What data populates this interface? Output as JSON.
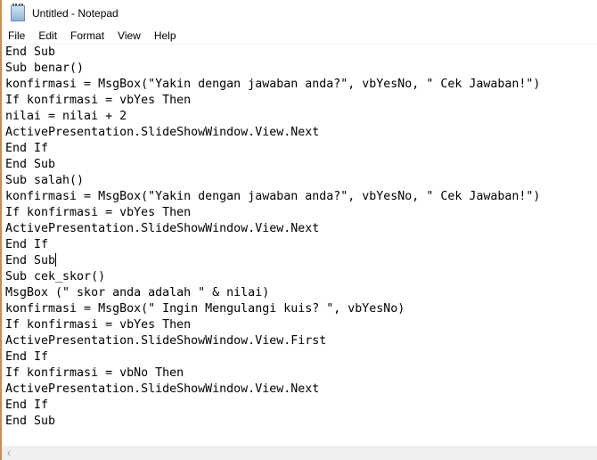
{
  "window": {
    "title": "Untitled - Notepad",
    "icon": "notepad-icon"
  },
  "menu": [
    "File",
    "Edit",
    "Format",
    "View",
    "Help"
  ],
  "editor": {
    "lines": [
      "End Sub",
      "Sub benar()",
      "konfirmasi = MsgBox(\"Yakin dengan jawaban anda?\", vbYesNo, \" Cek Jawaban!\")",
      "If konfirmasi = vbYes Then",
      "nilai = nilai + 2",
      "ActivePresentation.SlideShowWindow.View.Next",
      "End If",
      "End Sub",
      "Sub salah()",
      "konfirmasi = MsgBox(\"Yakin dengan jawaban anda?\", vbYesNo, \" Cek Jawaban!\")",
      "If konfirmasi = vbYes Then",
      "ActivePresentation.SlideShowWindow.View.Next",
      "End If",
      "End Sub",
      "Sub cek_skor()",
      "MsgBox (\" skor anda adalah \" & nilai)",
      "konfirmasi = MsgBox(\" Ingin Mengulangi kuis? \", vbYesNo)",
      "If konfirmasi = vbYes Then",
      "ActivePresentation.SlideShowWindow.View.First",
      "End If",
      "If konfirmasi = vbNo Then",
      "ActivePresentation.SlideShowWindow.View.Next",
      "End If",
      "End Sub"
    ],
    "caret_line": 13
  },
  "scrollbar": {
    "left_arrow": "‹"
  }
}
